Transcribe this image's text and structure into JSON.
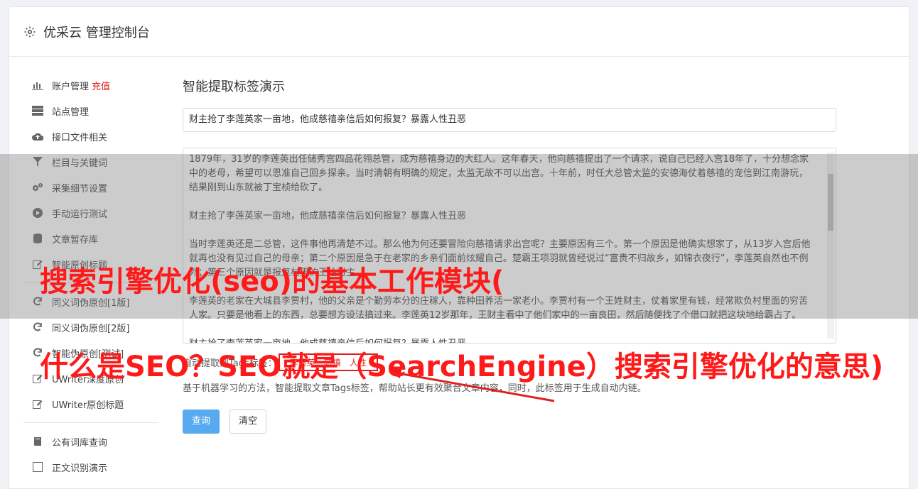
{
  "header": {
    "title": "优采云 管理控制台"
  },
  "sidebar": {
    "items": [
      {
        "label": "账户管理",
        "tag": "充值",
        "icon": "bar-chart-icon"
      },
      {
        "label": "站点管理",
        "icon": "server-icon"
      },
      {
        "label": "接口文件相关",
        "icon": "cloud-upload-icon"
      },
      {
        "label": "栏目与关键词",
        "icon": "filter-icon"
      },
      {
        "label": "采集细节设置",
        "icon": "cogs-icon"
      },
      {
        "label": "手动运行测试",
        "icon": "play-icon"
      },
      {
        "label": "文章暂存库",
        "icon": "database-icon"
      },
      {
        "label": "智能原创标题",
        "icon": "edit-icon"
      }
    ],
    "items2": [
      {
        "label": "同义词伪原创[1版]",
        "icon": "refresh-icon"
      },
      {
        "label": "同义词伪原创[2版]",
        "icon": "refresh-icon"
      },
      {
        "label": "智能伪原创[测试]",
        "icon": "refresh-icon"
      },
      {
        "label": "UWriter深度原创",
        "icon": "edit-icon"
      },
      {
        "label": "UWriter原创标题",
        "icon": "edit-icon"
      }
    ],
    "items3": [
      {
        "label": "公有词库查询",
        "icon": "book-icon"
      },
      {
        "label": "正文识别演示",
        "icon": "square-icon"
      }
    ]
  },
  "main": {
    "heading": "智能提取标签演示",
    "title_value": "财主抢了李莲英家一亩地，他成慈禧亲信后如何报复？暴露人性丑恶",
    "paragraphs": [
      "1879年，31岁的李莲英出任储秀宫四品花翎总管，成为慈禧身边的大红人。这年春天，他向慈禧提出了一个请求，说自己已经入宫18年了，十分想念家中的老母，希望可以恩准自己回乡探亲。当时清朝有明确的规定，太监无故不可以出宫。十年前，时任大总管太监的安德海仗着慈禧的宠信到江南游玩，结果刚到山东就被丁宝桢给砍了。",
      "财主抢了李莲英家一亩地，他成慈禧亲信后如何报复？暴露人性丑恶",
      "当时李莲英还是二总管，这件事他再清楚不过。那么他为何还要冒险向慈禧请求出宫呢？主要原因有三个。第一个原因是他确实想家了，从13岁入宫后他就再也没有见过自己的母亲；第二个原因是急于在老家的乡亲们面前炫耀自己。楚霸王项羽就曾经说过“富贵不归故乡，如锦衣夜行”，李莲英自然也不例外；第三个原因就是报复村里的王姓财主。",
      "李莲英的老家在大城县李贾村，他的父亲是个勤劳本分的庄稼人，靠种田养活一家老小。李贾村有一个王姓财主，仗着家里有钱，经常欺负村里面的穷苦人家。只要是他看上的东西，总要想方设法搞过来。李莲英12岁那年，王财主看中了他们家中的一亩良田，然后随便找了个借口就把这块地给霸占了。",
      "财主抢了李莲英家一亩地，他成慈禧亲信后如何报复？暴露人性丑恶"
    ],
    "tags_label": "自动提取到Tags标签：",
    "tags": [
      "李莲英",
      "慈禧",
      "人性"
    ],
    "hint": "基于机器学习的方法，智能提取文章Tags标签，帮助站长更有效聚合文章内容，同时，此标签用于生成自动内链。",
    "query_btn": "查询",
    "clear_btn": "清空"
  },
  "overlay": {
    "line1": "搜索引擎优化(seo)的基本工作模块(",
    "line2": "什么是SEO？SEO就是（SearchEngine）搜索引擎优化的意思)",
    "text_color": "#ff1a1a"
  }
}
